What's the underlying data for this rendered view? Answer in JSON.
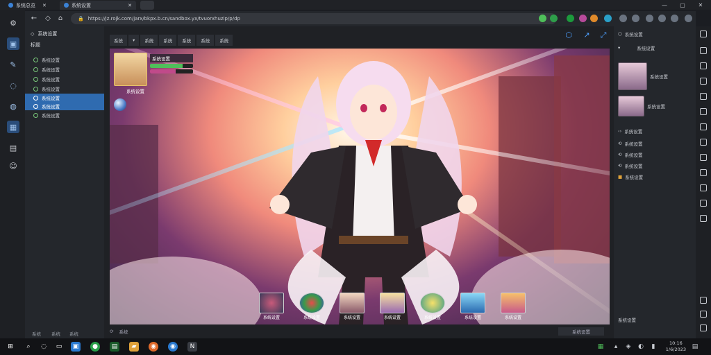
{
  "tabs": [
    {
      "label": "系统总览"
    },
    {
      "label": "系统设置"
    }
  ],
  "window_controls": {
    "minimize": "—",
    "maximize": "▢",
    "close": "✕"
  },
  "address": {
    "url": "https://jz.rojk.com/jarx/bkpx.b.cn/sandbox.yx/tvuorxhuzip/p/dp"
  },
  "left_panel": {
    "header1": "系统设置",
    "header2": "标题",
    "items": [
      {
        "label": "系统设置"
      },
      {
        "label": "系统设置"
      },
      {
        "label": "系统设置"
      },
      {
        "label": "系统设置"
      },
      {
        "label": "系统设置"
      },
      {
        "label": "系统设置"
      },
      {
        "label": "系统设置"
      }
    ],
    "footer": [
      "系统",
      "系统",
      "系统"
    ]
  },
  "toolbar": {
    "tabs": [
      "系统",
      "▾",
      "系统",
      "系统",
      "系统",
      "系统",
      "系统"
    ]
  },
  "hud": {
    "name": "系统设置",
    "hp_fraction": 0.75,
    "mp_fraction": 0.6,
    "level_label": "系统设置"
  },
  "skills": [
    {
      "label": "系统设置"
    },
    {
      "label": "系统设置"
    },
    {
      "label": "系统设置"
    },
    {
      "label": "系统设置"
    },
    {
      "label": "系统设置"
    },
    {
      "label": "系统设置"
    },
    {
      "label": "系统设置"
    }
  ],
  "main_status": {
    "left": "系统",
    "right": "系统设置"
  },
  "right_panel": {
    "header": "系统设置",
    "subheader": "系统设置",
    "rows": [
      {
        "label": "系统设置"
      },
      {
        "label": "系统设置"
      },
      {
        "label": "系统设置"
      },
      {
        "label": "系统设置"
      },
      {
        "label": "系统设置"
      },
      {
        "label": "系统设置"
      },
      {
        "label": "系统设置"
      }
    ],
    "footer": "系统设置"
  },
  "taskbar": {
    "time": "10:16",
    "date": "1/6/2023"
  },
  "colors": {
    "accent": "#2f6bb0",
    "hp": "#4fbf5a",
    "mp": "#c04a8a"
  }
}
